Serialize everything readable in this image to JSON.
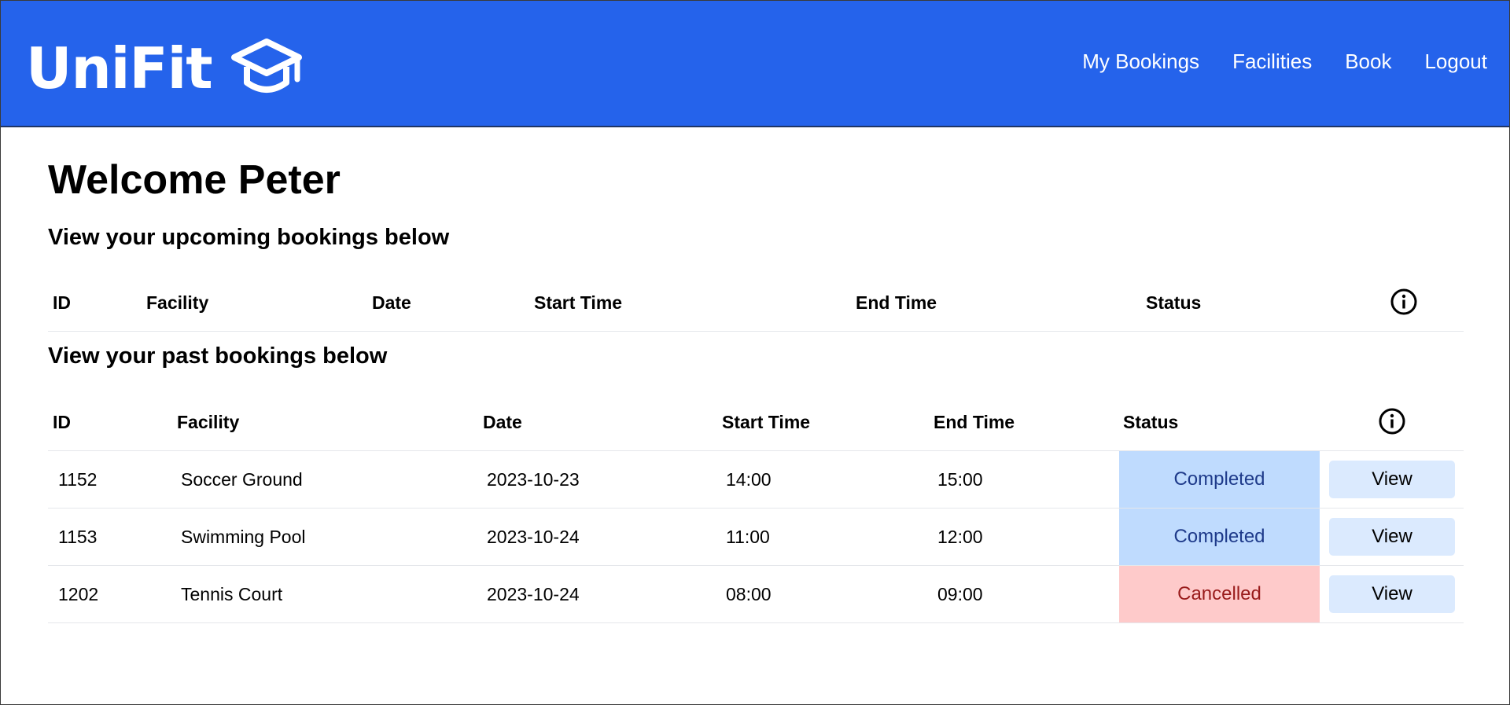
{
  "app": {
    "name": "UniFit",
    "logo_icon": "graduation-cap-icon"
  },
  "nav": {
    "items": [
      {
        "label": "My Bookings"
      },
      {
        "label": "Facilities"
      },
      {
        "label": "Book"
      },
      {
        "label": "Logout"
      }
    ]
  },
  "page": {
    "welcome": "Welcome Peter",
    "upcoming_subtitle": "View your upcoming bookings below",
    "past_subtitle": "View your past bookings below"
  },
  "table_headers": {
    "id": "ID",
    "facility": "Facility",
    "date": "Date",
    "start_time": "Start Time",
    "end_time": "End Time",
    "status": "Status",
    "info_icon": "info-icon"
  },
  "upcoming_bookings": [],
  "past_bookings": [
    {
      "id": "1152",
      "facility": "Soccer Ground",
      "date": "2023-10-23",
      "start": "14:00",
      "end": "15:00",
      "status": "Completed",
      "action": "View"
    },
    {
      "id": "1153",
      "facility": "Swimming Pool",
      "date": "2023-10-24",
      "start": "11:00",
      "end": "12:00",
      "status": "Completed",
      "action": "View"
    },
    {
      "id": "1202",
      "facility": "Tennis Court",
      "date": "2023-10-24",
      "start": "08:00",
      "end": "09:00",
      "status": "Cancelled",
      "action": "View"
    }
  ],
  "colors": {
    "header_bg": "#2563eb",
    "completed_bg": "#bfdbfe",
    "completed_text": "#1e3a8a",
    "cancelled_bg": "#fecaca",
    "cancelled_text": "#991b1b",
    "view_button_bg": "#dbeafe"
  }
}
